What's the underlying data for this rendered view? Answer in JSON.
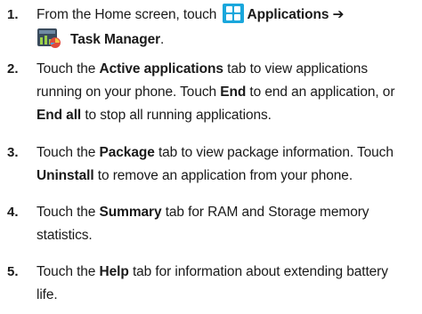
{
  "steps": [
    {
      "number": "1.",
      "line1_pre": "From the Home screen, touch ",
      "line1_bold": "Applications ➔",
      "line2_bold": "Task Manager",
      "line2_post": "."
    },
    {
      "number": "2.",
      "s1": "Touch the ",
      "b1": "Active applications",
      "s2": " tab to view applications",
      "s3": "running on your phone. Touch ",
      "b2": "End",
      "s4": " to end an application, or",
      "b3": "End all",
      "s5": " to stop all running applications."
    },
    {
      "number": "3.",
      "s1": "Touch the ",
      "b1": "Package",
      "s2": " tab to view package information. Touch",
      "b2": "Uninstall",
      "s3": " to remove an application from your phone."
    },
    {
      "number": "4.",
      "s1": "Touch the ",
      "b1": "Summary",
      "s2": " tab for RAM and Storage memory",
      "s3": "statistics."
    },
    {
      "number": "5.",
      "s1": "Touch the ",
      "b1": "Help",
      "s2": " tab for information about extending battery",
      "s3": "life."
    }
  ],
  "icons": {
    "applications": "applications-icon",
    "task_manager": "task-manager-icon"
  },
  "colors": {
    "applications_icon": "#1aa7dc",
    "text": "#1a1a1a"
  }
}
